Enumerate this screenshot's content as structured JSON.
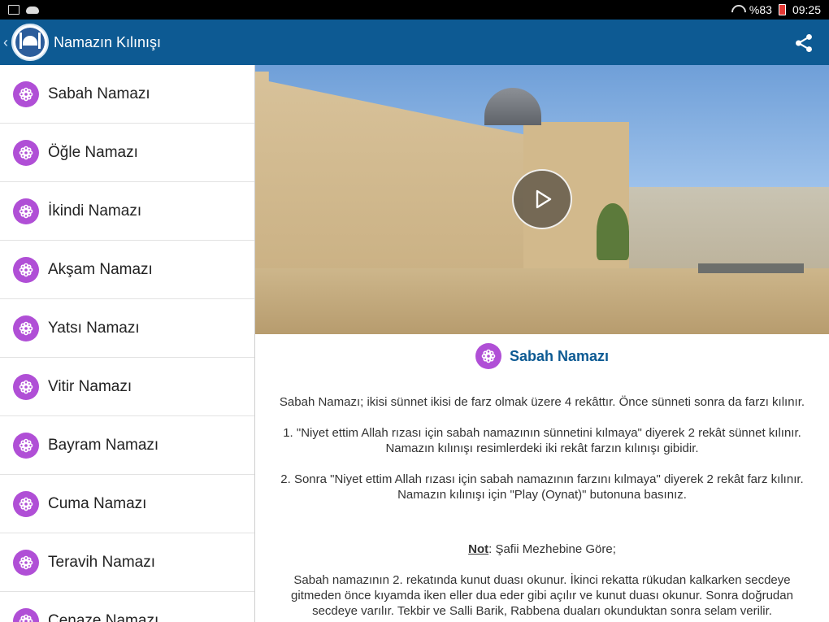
{
  "status": {
    "battery": "%83",
    "time": "09:25"
  },
  "appbar": {
    "title": "Namazın Kılınışı"
  },
  "sidebar": {
    "items": [
      {
        "label": "Sabah Namazı"
      },
      {
        "label": "Öğle Namazı"
      },
      {
        "label": "İkindi Namazı"
      },
      {
        "label": "Akşam Namazı"
      },
      {
        "label": "Yatsı Namazı"
      },
      {
        "label": "Vitir Namazı"
      },
      {
        "label": "Bayram Namazı"
      },
      {
        "label": "Cuma Namazı"
      },
      {
        "label": "Teravih Namazı"
      },
      {
        "label": "Cenaze Namazı"
      }
    ]
  },
  "content": {
    "title": "Sabah Namazı",
    "intro": "Sabah Namazı; ikisi sünnet ikisi de farz olmak üzere 4 rekâttır. Önce sünneti sonra da farzı kılınır.",
    "step1": "1. \"Niyet ettim Allah rızası için sabah namazının sünnetini kılmaya\" diyerek 2 rekât sünnet kılınır. Namazın kılınışı resimlerdeki iki rekât farzın kılınışı gibidir.",
    "step2": "2. Sonra \"Niyet ettim Allah rızası için sabah namazının farzını kılmaya\" diyerek 2 rekât farz kılınır. Namazın kılınışı için \"Play (Oynat)\" butonuna basınız.",
    "note_label": "Not",
    "note_text": ": Şafii Mezhebine Göre;",
    "note_body": "Sabah namazının 2. rekatında kunut duası okunur. İkinci rekatta rükudan kalkarken secdeye gitmeden önce kıyamda iken eller dua eder gibi açılır ve kunut duası okunur. Sonra doğrudan secdeye varılır. Tekbir ve Salli Barik, Rabbena duaları okunduktan sonra selam verilir."
  },
  "colors": {
    "appbar": "#0d5a93",
    "badge": "#b04fd6",
    "title_text": "#0d5a93"
  }
}
